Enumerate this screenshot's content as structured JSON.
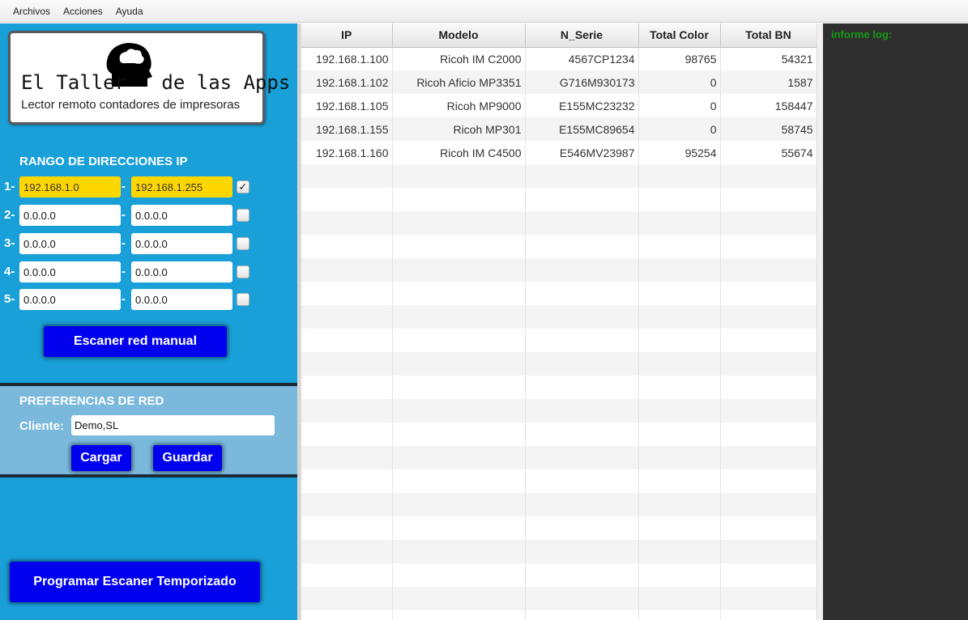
{
  "menu": [
    "Archivos",
    "Acciones",
    "Ayuda"
  ],
  "logo": {
    "title": "El Taller   de las Apps",
    "subtitle": "Lector remoto contadores de impresoras"
  },
  "ip_range": {
    "heading": "RANGO DE DIRECCIONES IP",
    "rows": [
      {
        "num": "1-",
        "start": "192.168.1.0",
        "end": "192.168.1.255",
        "checked": true
      },
      {
        "num": "2-",
        "start": "0.0.0.0",
        "end": "0.0.0.0",
        "checked": false
      },
      {
        "num": "3-",
        "start": "0.0.0.0",
        "end": "0.0.0.0",
        "checked": false
      },
      {
        "num": "4-",
        "start": "0.0.0.0",
        "end": "0.0.0.0",
        "checked": false
      },
      {
        "num": "5-",
        "start": "0.0.0.0",
        "end": "0.0.0.0",
        "checked": false
      }
    ],
    "dash": "-",
    "check_mark": "✓"
  },
  "manual_scan_label": "Escaner red manual",
  "prefs": {
    "heading": "PREFERENCIAS DE RED",
    "client_label": "Cliente:",
    "client_value": "Demo,SL",
    "load_label": "Cargar",
    "save_label": "Guardar"
  },
  "timed_scan_label": "Programar Escaner Temporizado",
  "table": {
    "columns": [
      "IP",
      "Modelo",
      "N_Serie",
      "Total Color",
      "Total BN"
    ],
    "rows": [
      [
        "192.168.1.100",
        "Ricoh IM C2000",
        "4567CP1234",
        "98765",
        "54321"
      ],
      [
        "192.168.1.102",
        "Ricoh Aficio MP3351",
        "G716M930173",
        "0",
        "1587"
      ],
      [
        "192.168.1.105",
        "Ricoh MP9000",
        "E155MC23232",
        "0",
        "158447"
      ],
      [
        "192.168.1.155",
        "Ricoh MP301",
        "E155MC89654",
        "0",
        "58745"
      ],
      [
        "192.168.1.160",
        "Ricoh IM C4500",
        "E546MV23987",
        "95254",
        "55674"
      ]
    ]
  },
  "log": {
    "label": "informe log:"
  },
  "colors": {
    "panel_blue": "#1aa0d8",
    "button_blue": "#0000ee",
    "highlight_yellow": "#ffd700",
    "log_bg": "#2f2f2f",
    "log_text": "#169b16"
  }
}
